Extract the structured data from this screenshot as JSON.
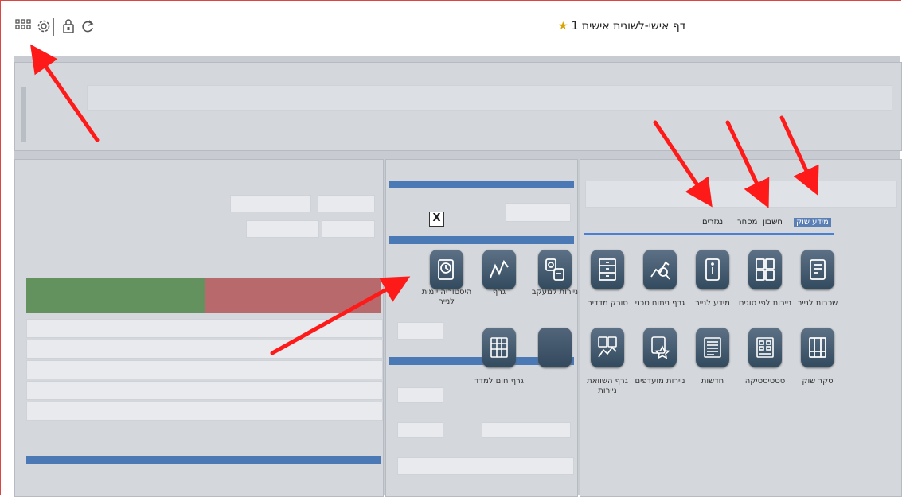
{
  "window": {
    "title": "דף אישי-לשונית אישית 1",
    "star_icon": "star-icon"
  },
  "toolbar": {
    "icons": [
      "grid-icon",
      "gear-icon",
      "lock-icon",
      "refresh-icon"
    ]
  },
  "tabs": {
    "items": [
      {
        "label": "מידע שוק",
        "active": true
      },
      {
        "label": "חשבון",
        "active": false
      },
      {
        "label": "מסחר",
        "active": false
      },
      {
        "label": "נגזרים",
        "active": false
      }
    ]
  },
  "tiles": [
    {
      "label": "שכבות לנייר",
      "icon": "layers-doc-icon"
    },
    {
      "label": "ניירות לפי סוגים",
      "icon": "grouped-docs-icon"
    },
    {
      "label": "מידע לנייר",
      "icon": "info-doc-icon"
    },
    {
      "label": "גרף ניתוח טכני",
      "icon": "technical-chart-icon"
    },
    {
      "label": "סורק מדדים",
      "icon": "scanner-icon"
    },
    {
      "label": "ניירות למעקב",
      "icon": "watchlist-icon"
    },
    {
      "label": "גרף",
      "icon": "line-chart-icon"
    },
    {
      "label": "היסטוריה יומית לנייר",
      "icon": "history-icon"
    },
    {
      "label": "סקר שוק",
      "icon": "market-survey-icon"
    },
    {
      "label": "סטטיסטיקה",
      "icon": "statistics-icon"
    },
    {
      "label": "חדשות",
      "icon": "news-icon"
    },
    {
      "label": "ניירות מועדפים",
      "icon": "favorites-icon"
    },
    {
      "label": "גרף השוואת ניירות",
      "icon": "compare-chart-icon"
    },
    {
      "label": "",
      "icon": "blank-tile-icon"
    },
    {
      "label": "גרף חום למדד",
      "icon": "heatmap-icon"
    }
  ],
  "dialog": {
    "close_label": "X"
  },
  "colors": {
    "arrow": "#ff1a1a",
    "tile": "#3a5064",
    "tab_active": "#5a7fb4"
  }
}
